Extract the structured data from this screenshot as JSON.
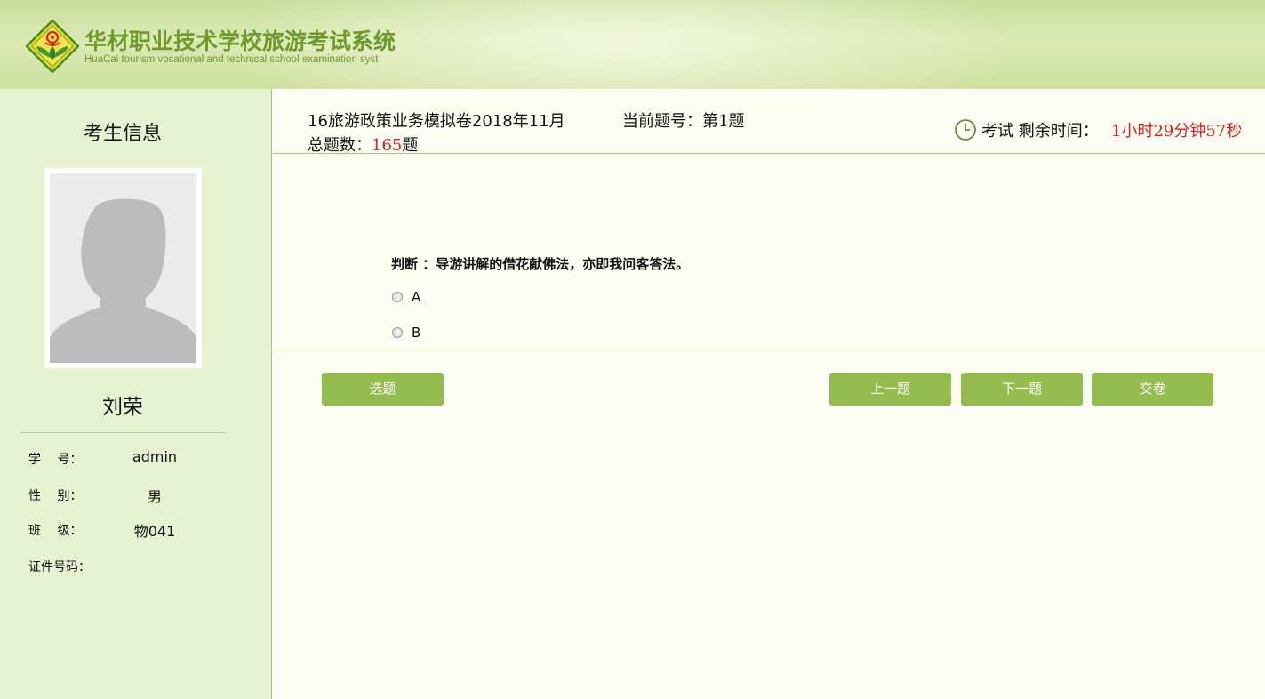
{
  "header": {
    "title_cn": "华材职业技术学校旅游考试系统",
    "title_en": "HuaCai tourism vocational and technical school examination syst",
    "logo_icon": "huacai-logo-icon"
  },
  "sidebar": {
    "title": "考生信息",
    "avatar_icon": "user-silhouette-icon",
    "student_name": "刘荣",
    "fields": [
      {
        "label": "学　 号：",
        "value": "admin"
      },
      {
        "label": "性　 别：",
        "value": "男"
      },
      {
        "label": "班　 级：",
        "value": "物041"
      },
      {
        "label": "证件号码：",
        "value": ""
      }
    ]
  },
  "exam": {
    "name": "16旅游政策业务模拟卷2018年11月",
    "current_label": "当前题号：",
    "current_value": "第1题",
    "total_label": "总题数：",
    "total_value": "165",
    "total_unit": "题",
    "timer_label": "考试 剩余时间：",
    "timer_value": "1小时29分钟57秒",
    "timer_icon": "clock-icon"
  },
  "question": {
    "text": "判断 ：导游讲解的借花献佛法，亦即我问客答法。",
    "options": [
      {
        "label": "A",
        "selected": false
      },
      {
        "label": "B",
        "selected": false
      }
    ]
  },
  "buttons": {
    "select": "选题",
    "prev": "上一题",
    "next": "下一题",
    "submit": "交卷"
  },
  "colors": {
    "accent_green": "#93bb4e",
    "title_green": "#6e9a2c",
    "sidebar_bg": "#e6f2d2",
    "highlight_red": "#e02020"
  }
}
